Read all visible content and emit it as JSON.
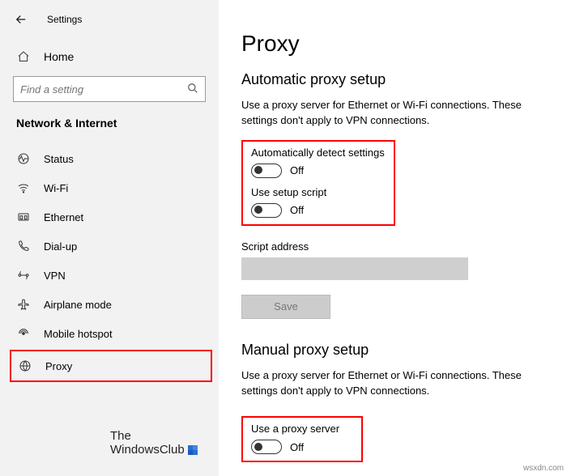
{
  "window": {
    "title": "Settings",
    "home_label": "Home"
  },
  "search": {
    "placeholder": "Find a setting"
  },
  "category": {
    "title": "Network & Internet"
  },
  "sidebar": {
    "items": [
      {
        "label": "Status"
      },
      {
        "label": "Wi-Fi"
      },
      {
        "label": "Ethernet"
      },
      {
        "label": "Dial-up"
      },
      {
        "label": "VPN"
      },
      {
        "label": "Airplane mode"
      },
      {
        "label": "Mobile hotspot"
      },
      {
        "label": "Proxy"
      }
    ]
  },
  "content": {
    "page_title": "Proxy",
    "auto": {
      "section_title": "Automatic proxy setup",
      "help": "Use a proxy server for Ethernet or Wi-Fi connections. These settings don't apply to VPN connections.",
      "detect": {
        "label": "Automatically detect settings",
        "state": "Off"
      },
      "script": {
        "label": "Use setup script",
        "state": "Off"
      },
      "script_address_label": "Script address",
      "script_address_value": "",
      "save_label": "Save"
    },
    "manual": {
      "section_title": "Manual proxy setup",
      "help": "Use a proxy server for Ethernet or Wi-Fi connections. These settings don't apply to VPN connections.",
      "use_proxy": {
        "label": "Use a proxy server",
        "state": "Off"
      }
    }
  },
  "watermark": {
    "line1": "The",
    "line2": "WindowsClub"
  },
  "attribution": "wsxdn.com"
}
